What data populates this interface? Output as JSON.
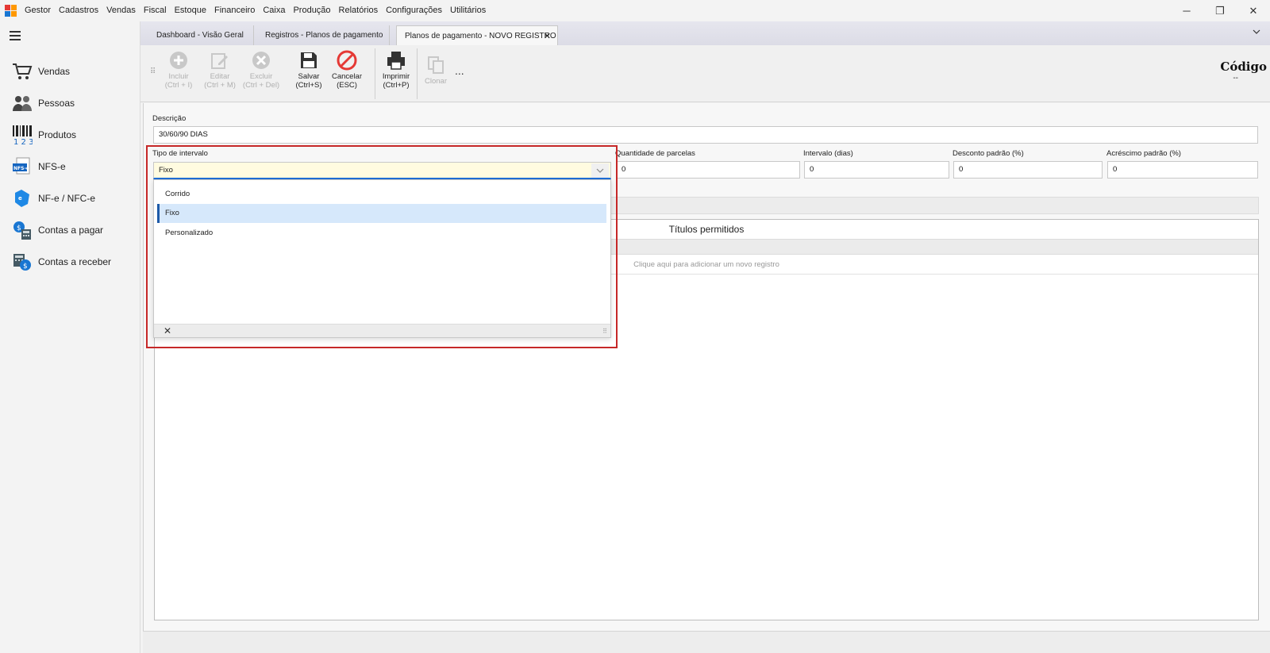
{
  "menu": {
    "items": [
      "Gestor",
      "Cadastros",
      "Vendas",
      "Fiscal",
      "Estoque",
      "Financeiro",
      "Caixa",
      "Produção",
      "Relatórios",
      "Configurações",
      "Utilitários"
    ]
  },
  "window": {
    "minimize": "─",
    "restore": "❐",
    "close": "✕"
  },
  "sidebar": {
    "items": [
      {
        "label": "Vendas",
        "icon": "cart-icon"
      },
      {
        "label": "Pessoas",
        "icon": "people-icon"
      },
      {
        "label": "Produtos",
        "icon": "barcode-icon"
      },
      {
        "label": "NFS-e",
        "icon": "nfse-icon"
      },
      {
        "label": "NF-e / NFC-e",
        "icon": "nfe-icon"
      },
      {
        "label": "Contas a pagar",
        "icon": "payables-icon"
      },
      {
        "label": "Contas a receber",
        "icon": "receivables-icon"
      }
    ]
  },
  "tabs": [
    {
      "label": "Dashboard - Visão Geral"
    },
    {
      "label": "Registros - Planos de pagamento"
    },
    {
      "label": "Planos de pagamento - NOVO REGISTRO",
      "close": "✕"
    }
  ],
  "toolbar": {
    "incluir": {
      "line1": "Incluir",
      "line2": "(Ctrl + I)"
    },
    "editar": {
      "line1": "Editar",
      "line2": "(Ctrl + M)"
    },
    "excluir": {
      "line1": "Excluir",
      "line2": "(Ctrl + Del)"
    },
    "salvar": {
      "line1": "Salvar",
      "line2": "(Ctrl+S)"
    },
    "cancelar": {
      "line1": "Cancelar",
      "line2": "(ESC)"
    },
    "imprimir": {
      "line1": "Imprimir",
      "line2": "(Ctrl+P)"
    },
    "clonar": {
      "line1": "Clonar"
    },
    "more": "..."
  },
  "header": {
    "codigo_label": "Código",
    "codigo_value": "--"
  },
  "form": {
    "descricao_label": "Descrição",
    "descricao_value": "30/60/90 DIAS",
    "tipo_intervalo_label": "Tipo de intervalo",
    "tipo_intervalo_value": "Fixo",
    "quantidade_label": "Quantidade de parcelas",
    "quantidade_value": "0",
    "intervalo_label": "Intervalo (dias)",
    "intervalo_value": "0",
    "desconto_label": "Desconto padrão (%)",
    "desconto_value": "0",
    "acrescimo_label": "Acréscimo padrão (%)",
    "acrescimo_value": "0"
  },
  "dropdown": {
    "options": [
      "Corrido",
      "Fixo",
      "Personalizado"
    ],
    "selected": "Fixo",
    "close": "✕"
  },
  "grid": {
    "title": "Títulos permitidos",
    "add_placeholder": "Clique aqui para adicionar um novo registro"
  },
  "colors": {
    "accent": "#1e6fd9",
    "highlight_border": "#c62828",
    "cancel_red": "#e53935",
    "selected_bg": "#d6e8fb"
  }
}
